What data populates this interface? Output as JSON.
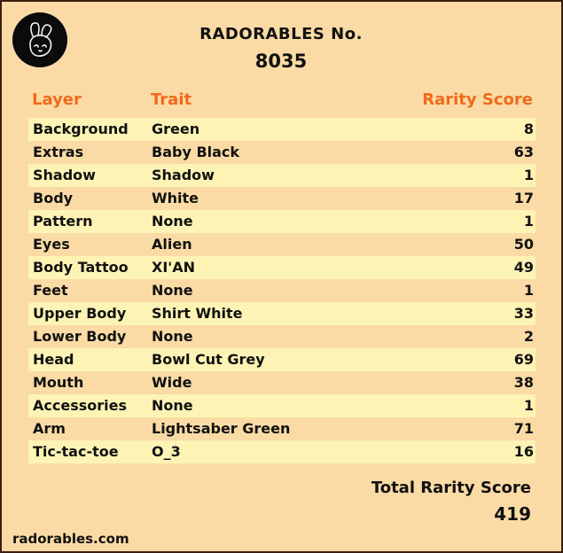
{
  "header": {
    "title": "RADORABLES No.",
    "number": "8035",
    "logo_icon": "bunny-head-icon"
  },
  "columns": {
    "layer": "Layer",
    "trait": "Trait",
    "score": "Rarity Score"
  },
  "rows": [
    {
      "layer": "Background",
      "trait": "Green",
      "score": "8"
    },
    {
      "layer": "Extras",
      "trait": "Baby Black",
      "score": "63"
    },
    {
      "layer": "Shadow",
      "trait": "Shadow",
      "score": "1"
    },
    {
      "layer": "Body",
      "trait": "White",
      "score": "17"
    },
    {
      "layer": "Pattern",
      "trait": "None",
      "score": "1"
    },
    {
      "layer": "Eyes",
      "trait": "Alien",
      "score": "50"
    },
    {
      "layer": "Body Tattoo",
      "trait": "XI'AN",
      "score": "49"
    },
    {
      "layer": "Feet",
      "trait": "None",
      "score": "1"
    },
    {
      "layer": "Upper Body",
      "trait": "Shirt White",
      "score": "33"
    },
    {
      "layer": "Lower Body",
      "trait": "None",
      "score": "2"
    },
    {
      "layer": "Head",
      "trait": "Bowl Cut Grey",
      "score": "69"
    },
    {
      "layer": "Mouth",
      "trait": "Wide",
      "score": "38"
    },
    {
      "layer": "Accessories",
      "trait": "None",
      "score": "1"
    },
    {
      "layer": "Arm",
      "trait": "Lightsaber Green",
      "score": "71"
    },
    {
      "layer": "Tic-tac-toe",
      "trait": "O_3",
      "score": "16"
    }
  ],
  "total": {
    "label": "Total Rarity Score",
    "value": "419"
  },
  "footer": {
    "site": "radorables.com"
  },
  "colors": {
    "background": "#fbdba5",
    "row_alt": "#fdf3b5",
    "header_accent": "#f06a1a",
    "border": "#3a1d10"
  }
}
